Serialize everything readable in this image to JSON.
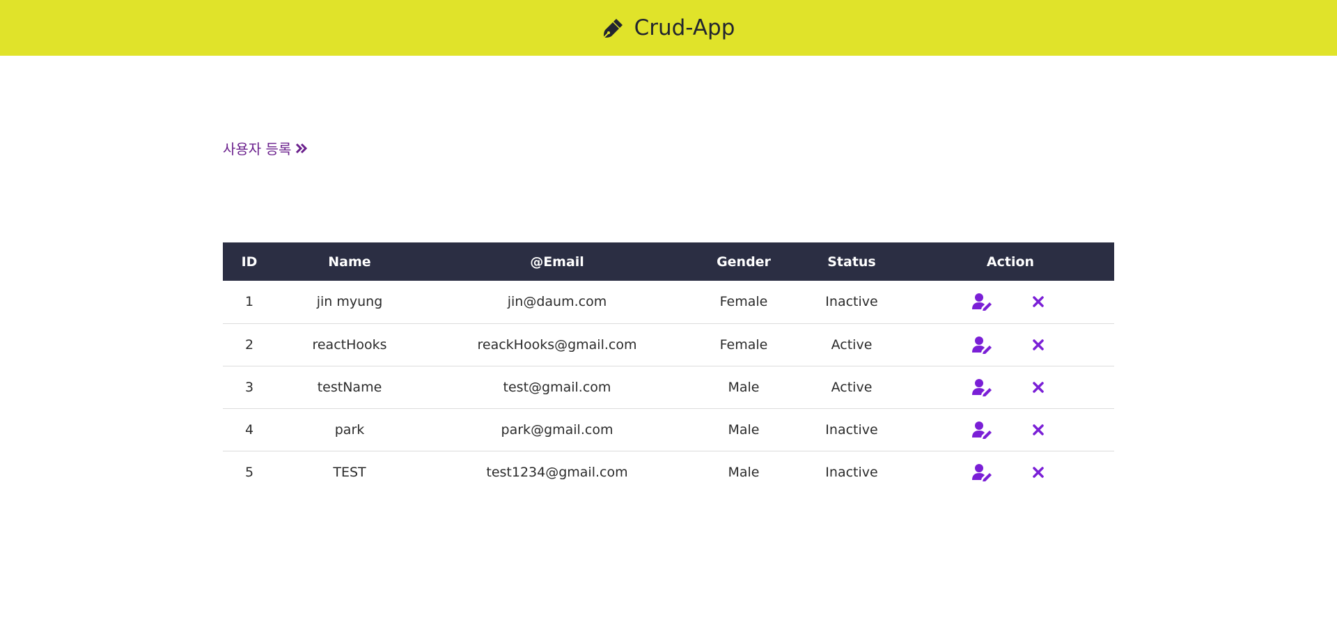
{
  "header": {
    "title": "Crud-App",
    "icon": "pen-icon",
    "background_color": "#e0e32a"
  },
  "add_user_link": {
    "label": "사용자 등록",
    "icon": "double-chevron-right-icon",
    "color": "#6a1f8c"
  },
  "table": {
    "header_background": "#2b2e43",
    "columns": [
      "ID",
      "Name",
      "@Email",
      "Gender",
      "Status",
      "Action"
    ],
    "rows": [
      {
        "id": "1",
        "name": "jin myung",
        "email": "jin@daum.com",
        "gender": "Female",
        "status": "Inactive"
      },
      {
        "id": "2",
        "name": "reactHooks",
        "email": "reackHooks@gmail.com",
        "gender": "Female",
        "status": "Active"
      },
      {
        "id": "3",
        "name": "testName",
        "email": "test@gmail.com",
        "gender": "Male",
        "status": "Active"
      },
      {
        "id": "4",
        "name": "park",
        "email": "park@gmail.com",
        "gender": "Male",
        "status": "Inactive"
      },
      {
        "id": "5",
        "name": "TEST",
        "email": "test1234@gmail.com",
        "gender": "Male",
        "status": "Inactive"
      }
    ],
    "action_icons": {
      "edit": "user-edit-icon",
      "delete": "close-icon",
      "color": "#7a1fd6"
    }
  }
}
